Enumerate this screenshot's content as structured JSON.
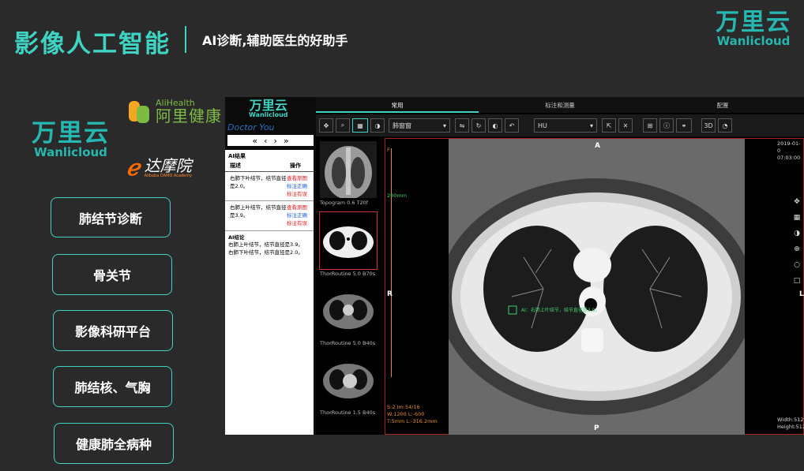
{
  "header": {
    "title": "影像人工智能",
    "subtitle": "AI诊断,辅助医生的好助手"
  },
  "brand": {
    "cn": "万里云",
    "en": "Wanlicloud"
  },
  "partners": {
    "alihealth_en": "AliHealth",
    "alihealth_cn": "阿里健康",
    "damo_cn": "达摩院",
    "damo_en": "Alibaba DAMO Academy"
  },
  "menu": [
    {
      "label": "肺结节诊断"
    },
    {
      "label": "骨关节"
    },
    {
      "label": "影像科研平台"
    },
    {
      "label": "肺结核、气胸"
    },
    {
      "label": "健康肺全病种"
    }
  ],
  "viewer": {
    "logo_cn": "万里云",
    "logo_en": "Wanlicloud",
    "doctor_you": "Doctor You",
    "nav": [
      "«",
      "‹",
      "›",
      "»"
    ],
    "tabs": [
      "常用",
      "标注和测量",
      "配置"
    ],
    "window_select": "肺窗窗",
    "unit_select": "HU",
    "btn_3d": "3D",
    "ai_panel": {
      "header": "AI结果",
      "col_desc": "描述",
      "col_ops": "操作",
      "rows": [
        {
          "desc": "右肺下叶结节，结节直径是2.0。",
          "ops": [
            "查看原",
            "图",
            "标注",
            "正确",
            "标",
            "注有误"
          ]
        },
        {
          "desc": "右肺上叶结节，结节直径是3.9。",
          "ops": [
            "查看原",
            "图",
            "标注",
            "正确",
            "标",
            "注有误"
          ]
        }
      ],
      "conclusion_header": "AI结论",
      "conclusion": [
        "右肺上叶结节，结节直径是3.9。",
        "右肺下叶结节，结节直径是2.0。"
      ]
    },
    "thumbnails": [
      {
        "label": "Topogram 0.6 T20f"
      },
      {
        "label": "ThorRoutine 5.0 B70s"
      },
      {
        "label": "ThorRoutine 5.0 B40s"
      },
      {
        "label": "ThorRoutine 1.5 B40s"
      }
    ],
    "image": {
      "orient_top": "A",
      "orient_left": "R",
      "orient_bottom": "P",
      "orient_right": "L",
      "orient_f": "F",
      "scale": "200mm",
      "date": "2019-01-0",
      "time": "07:03:00",
      "annotation": "AI：右肺上叶结节，结节直径是3.9。",
      "info_lines": [
        "S:2 Im:54/16",
        "W:1200 L:-600",
        "T:5mm L:-316.2mm"
      ],
      "width_text": "Width:512",
      "height_text": "Height:512"
    }
  },
  "colors": {
    "accent": "#3fd3c3",
    "background": "#2a2a2a"
  }
}
